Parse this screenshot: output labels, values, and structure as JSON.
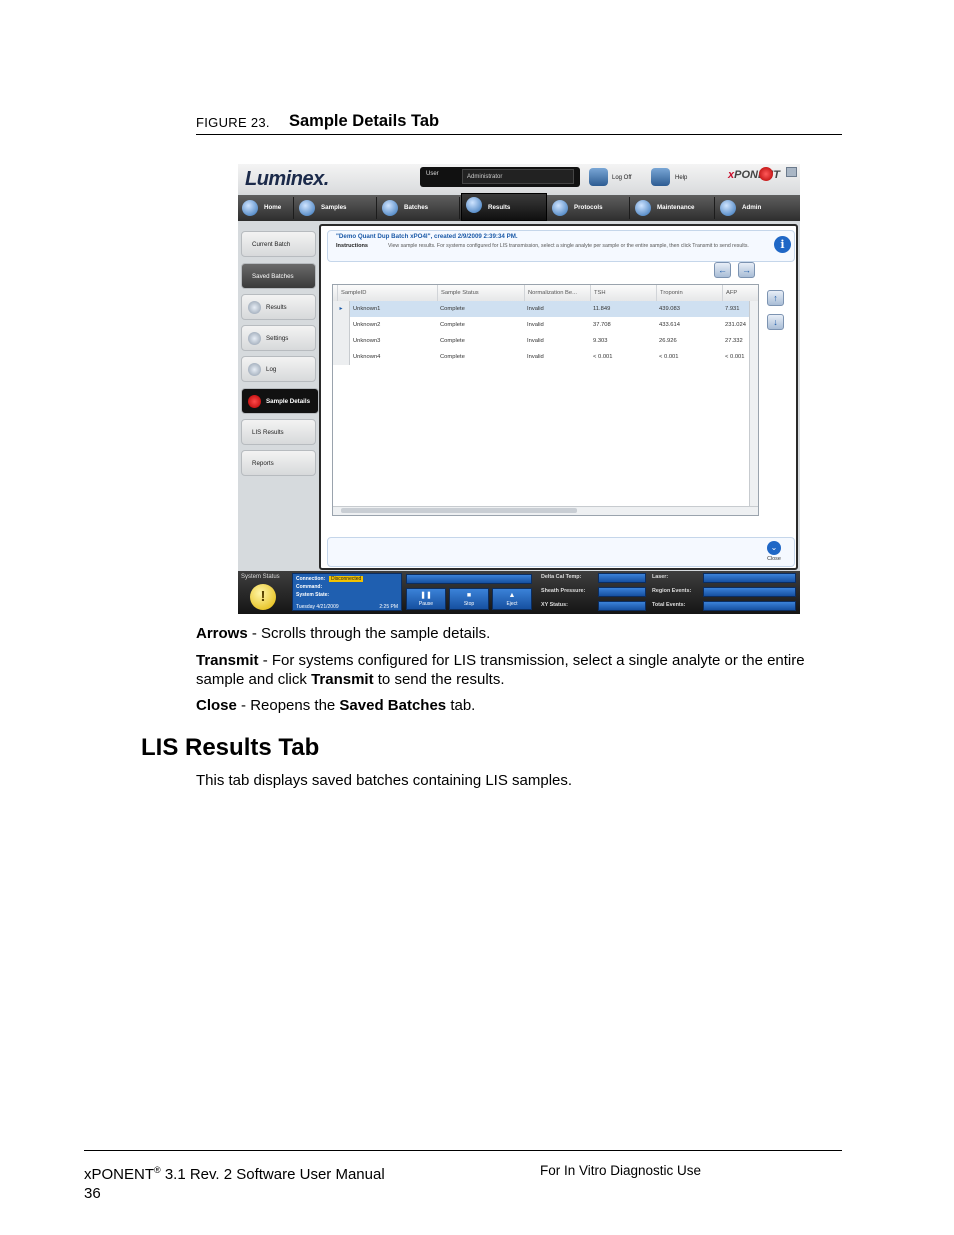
{
  "figure": {
    "number": "FIGURE 23.",
    "title": "Sample Details Tab"
  },
  "screenshot": {
    "logo": "Luminex.",
    "user_label": "User",
    "user_value": "Administrator",
    "logoff_label": "Log Off",
    "help_label": "Help",
    "brand_prefix": "x",
    "brand_name": "PONENT",
    "nav_tabs": [
      "Home",
      "Samples",
      "Batches",
      "Results",
      "Protocols",
      "Maintenance",
      "Admin"
    ],
    "side_buttons": [
      "Current Batch",
      "Saved Batches",
      "Results",
      "Settings",
      "Log",
      "Sample Details",
      "LIS Results",
      "Reports"
    ],
    "batch_title": "\"Demo Quant Dup Batch xPO4l\", created 2/9/2009 2:39:34 PM.",
    "instructions_label": "Instructions",
    "instructions_text": "View sample results. For systems configured for LIS transmission, select a single analyte per sample or the entire sample, then click Transmit to send results.",
    "grid": {
      "headers": [
        "SampleID",
        "Sample Status",
        "Normalization Be...",
        "TSH",
        "Troponin",
        "AFP"
      ],
      "rows": [
        [
          "Unknown1",
          "Complete",
          "Invalid",
          "11.849",
          "439.083",
          "7.931"
        ],
        [
          "Unknown2",
          "Complete",
          "Invalid",
          "37.708",
          "433.614",
          "231.024"
        ],
        [
          "Unknown3",
          "Complete",
          "Invalid",
          "9.303",
          "26.926",
          "27.332"
        ],
        [
          "Unknown4",
          "Complete",
          "Invalid",
          "< 0.001",
          "< 0.001",
          "< 0.001"
        ]
      ]
    },
    "close_label": "Close",
    "status": {
      "title": "System Status",
      "connection_label": "Connection:",
      "connection_value": "Disconnected",
      "command_label": "Command:",
      "state_label": "System State:",
      "date": "Tuesday 4/21/2009",
      "time": "2:25 PM",
      "buttons": [
        "Pause",
        "Stop",
        "Eject"
      ],
      "labels_mid": [
        "Delta Cal Temp:",
        "Sheath Pressure:",
        "XY Status:"
      ],
      "labels_right": [
        "Laser:",
        "Region Events:",
        "Total Events:"
      ]
    },
    "colors": {
      "accent": "#1f67c6",
      "selected_row": "#cfe0f1",
      "warning": "#e0b400"
    }
  },
  "body": {
    "arrows_term": "Arrows",
    "arrows_desc": " - Scrolls through the sample details.",
    "transmit_term": "Transmit",
    "transmit_desc_1": " - For systems configured for LIS transmission, select a single analyte or the entire sample and click ",
    "transmit_term_2": "Transmit",
    "transmit_desc_2": " to send the results.",
    "close_term": "Close",
    "close_desc_1": " - Reopens the ",
    "close_term_2": "Saved Batches",
    "close_desc_2": " tab.",
    "heading": "LIS Results Tab",
    "heading_para": "This tab displays saved batches containing LIS samples."
  },
  "footer": {
    "product": "xPONENT",
    "reg": "®",
    "manual": " 3.1 Rev. 2 Software User Manual",
    "page": "36",
    "right": "For In Vitro Diagnostic Use"
  }
}
